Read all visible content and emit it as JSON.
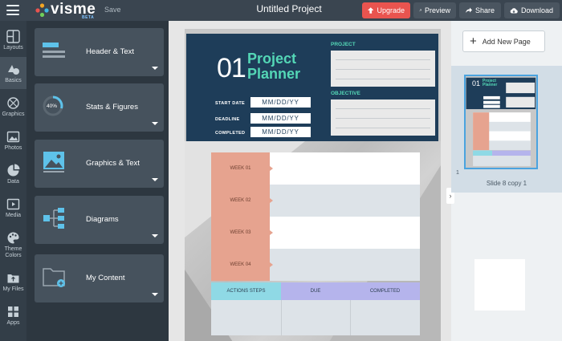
{
  "app": {
    "logo_text": "visme",
    "beta_label": "BETA",
    "save_label": "Save",
    "document_title": "Untitled Project"
  },
  "toolbar": {
    "upgrade_label": "Upgrade",
    "preview_label": "Preview",
    "share_label": "Share",
    "download_label": "Download"
  },
  "rail": {
    "items": [
      {
        "label": "Layouts",
        "icon": "layouts-icon"
      },
      {
        "label": "Basics",
        "icon": "basics-icon"
      },
      {
        "label": "Graphics",
        "icon": "graphics-icon"
      },
      {
        "label": "Photos",
        "icon": "photos-icon"
      },
      {
        "label": "Data",
        "icon": "data-icon"
      },
      {
        "label": "Media",
        "icon": "media-icon"
      },
      {
        "label": "Theme Colors",
        "icon": "palette-icon"
      },
      {
        "label": "My Files",
        "icon": "files-icon"
      },
      {
        "label": "Apps",
        "icon": "apps-icon"
      }
    ]
  },
  "panel": {
    "cards": [
      {
        "label": "Header & Text",
        "icon": "header-text-icon"
      },
      {
        "label": "Stats & Figures",
        "icon": "stats-icon",
        "badge": "40%"
      },
      {
        "label": "Graphics & Text",
        "icon": "image-icon"
      },
      {
        "label": "Diagrams",
        "icon": "diagram-icon"
      },
      {
        "label": "My Content",
        "icon": "folder-icon"
      }
    ]
  },
  "slide": {
    "number": "01",
    "title_line1": "Project",
    "title_line2": "Planner",
    "fields": [
      {
        "label": "START DATE",
        "value": "MM/DD/YY"
      },
      {
        "label": "DEADLINE",
        "value": "MM/DD/YY"
      },
      {
        "label": "COMPLETED",
        "value": "MM/DD/YY"
      }
    ],
    "project_label": "PROJECT",
    "objective_label": "OBJECTIVE",
    "weeks": [
      "WEEK 01",
      "WEEK 02",
      "WEEK 03",
      "WEEK 04"
    ],
    "action_headers": [
      "ACTIONS STEPS",
      "DUE",
      "COMPLETED"
    ]
  },
  "pages": {
    "add_label": "Add New Page",
    "slide_number": "1",
    "slide_name": "Slide 8 copy 1"
  },
  "colors": {
    "accent": "#e9544f",
    "slide_navy": "#1e3d59",
    "slide_teal": "#54d7b6",
    "week_salmon": "#e6a38f",
    "selection_blue": "#4aa3df"
  }
}
